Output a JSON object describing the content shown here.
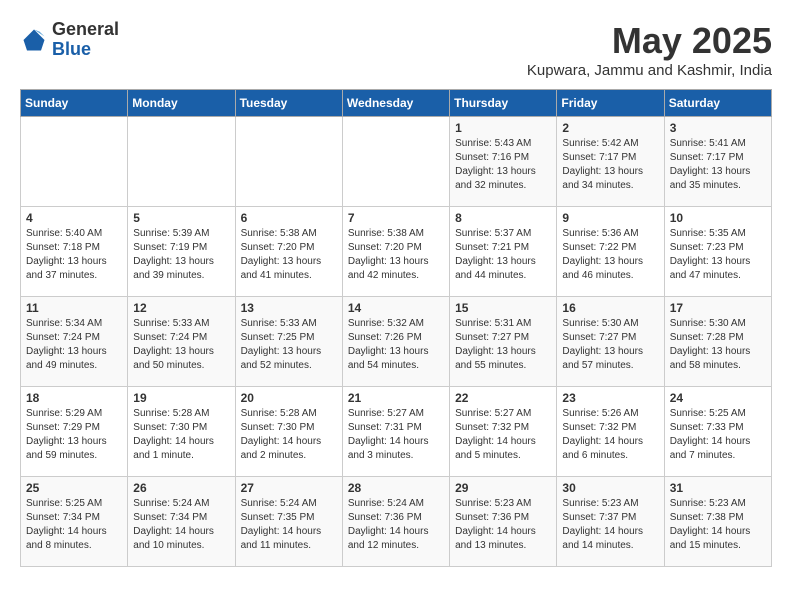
{
  "header": {
    "logo_general": "General",
    "logo_blue": "Blue",
    "title": "May 2025",
    "location": "Kupwara, Jammu and Kashmir, India"
  },
  "weekdays": [
    "Sunday",
    "Monday",
    "Tuesday",
    "Wednesday",
    "Thursday",
    "Friday",
    "Saturday"
  ],
  "weeks": [
    [
      {
        "day": "",
        "info": ""
      },
      {
        "day": "",
        "info": ""
      },
      {
        "day": "",
        "info": ""
      },
      {
        "day": "",
        "info": ""
      },
      {
        "day": "1",
        "info": "Sunrise: 5:43 AM\nSunset: 7:16 PM\nDaylight: 13 hours\nand 32 minutes."
      },
      {
        "day": "2",
        "info": "Sunrise: 5:42 AM\nSunset: 7:17 PM\nDaylight: 13 hours\nand 34 minutes."
      },
      {
        "day": "3",
        "info": "Sunrise: 5:41 AM\nSunset: 7:17 PM\nDaylight: 13 hours\nand 35 minutes."
      }
    ],
    [
      {
        "day": "4",
        "info": "Sunrise: 5:40 AM\nSunset: 7:18 PM\nDaylight: 13 hours\nand 37 minutes."
      },
      {
        "day": "5",
        "info": "Sunrise: 5:39 AM\nSunset: 7:19 PM\nDaylight: 13 hours\nand 39 minutes."
      },
      {
        "day": "6",
        "info": "Sunrise: 5:38 AM\nSunset: 7:20 PM\nDaylight: 13 hours\nand 41 minutes."
      },
      {
        "day": "7",
        "info": "Sunrise: 5:38 AM\nSunset: 7:20 PM\nDaylight: 13 hours\nand 42 minutes."
      },
      {
        "day": "8",
        "info": "Sunrise: 5:37 AM\nSunset: 7:21 PM\nDaylight: 13 hours\nand 44 minutes."
      },
      {
        "day": "9",
        "info": "Sunrise: 5:36 AM\nSunset: 7:22 PM\nDaylight: 13 hours\nand 46 minutes."
      },
      {
        "day": "10",
        "info": "Sunrise: 5:35 AM\nSunset: 7:23 PM\nDaylight: 13 hours\nand 47 minutes."
      }
    ],
    [
      {
        "day": "11",
        "info": "Sunrise: 5:34 AM\nSunset: 7:24 PM\nDaylight: 13 hours\nand 49 minutes."
      },
      {
        "day": "12",
        "info": "Sunrise: 5:33 AM\nSunset: 7:24 PM\nDaylight: 13 hours\nand 50 minutes."
      },
      {
        "day": "13",
        "info": "Sunrise: 5:33 AM\nSunset: 7:25 PM\nDaylight: 13 hours\nand 52 minutes."
      },
      {
        "day": "14",
        "info": "Sunrise: 5:32 AM\nSunset: 7:26 PM\nDaylight: 13 hours\nand 54 minutes."
      },
      {
        "day": "15",
        "info": "Sunrise: 5:31 AM\nSunset: 7:27 PM\nDaylight: 13 hours\nand 55 minutes."
      },
      {
        "day": "16",
        "info": "Sunrise: 5:30 AM\nSunset: 7:27 PM\nDaylight: 13 hours\nand 57 minutes."
      },
      {
        "day": "17",
        "info": "Sunrise: 5:30 AM\nSunset: 7:28 PM\nDaylight: 13 hours\nand 58 minutes."
      }
    ],
    [
      {
        "day": "18",
        "info": "Sunrise: 5:29 AM\nSunset: 7:29 PM\nDaylight: 13 hours\nand 59 minutes."
      },
      {
        "day": "19",
        "info": "Sunrise: 5:28 AM\nSunset: 7:30 PM\nDaylight: 14 hours\nand 1 minute."
      },
      {
        "day": "20",
        "info": "Sunrise: 5:28 AM\nSunset: 7:30 PM\nDaylight: 14 hours\nand 2 minutes."
      },
      {
        "day": "21",
        "info": "Sunrise: 5:27 AM\nSunset: 7:31 PM\nDaylight: 14 hours\nand 3 minutes."
      },
      {
        "day": "22",
        "info": "Sunrise: 5:27 AM\nSunset: 7:32 PM\nDaylight: 14 hours\nand 5 minutes."
      },
      {
        "day": "23",
        "info": "Sunrise: 5:26 AM\nSunset: 7:32 PM\nDaylight: 14 hours\nand 6 minutes."
      },
      {
        "day": "24",
        "info": "Sunrise: 5:25 AM\nSunset: 7:33 PM\nDaylight: 14 hours\nand 7 minutes."
      }
    ],
    [
      {
        "day": "25",
        "info": "Sunrise: 5:25 AM\nSunset: 7:34 PM\nDaylight: 14 hours\nand 8 minutes."
      },
      {
        "day": "26",
        "info": "Sunrise: 5:24 AM\nSunset: 7:34 PM\nDaylight: 14 hours\nand 10 minutes."
      },
      {
        "day": "27",
        "info": "Sunrise: 5:24 AM\nSunset: 7:35 PM\nDaylight: 14 hours\nand 11 minutes."
      },
      {
        "day": "28",
        "info": "Sunrise: 5:24 AM\nSunset: 7:36 PM\nDaylight: 14 hours\nand 12 minutes."
      },
      {
        "day": "29",
        "info": "Sunrise: 5:23 AM\nSunset: 7:36 PM\nDaylight: 14 hours\nand 13 minutes."
      },
      {
        "day": "30",
        "info": "Sunrise: 5:23 AM\nSunset: 7:37 PM\nDaylight: 14 hours\nand 14 minutes."
      },
      {
        "day": "31",
        "info": "Sunrise: 5:23 AM\nSunset: 7:38 PM\nDaylight: 14 hours\nand 15 minutes."
      }
    ]
  ]
}
